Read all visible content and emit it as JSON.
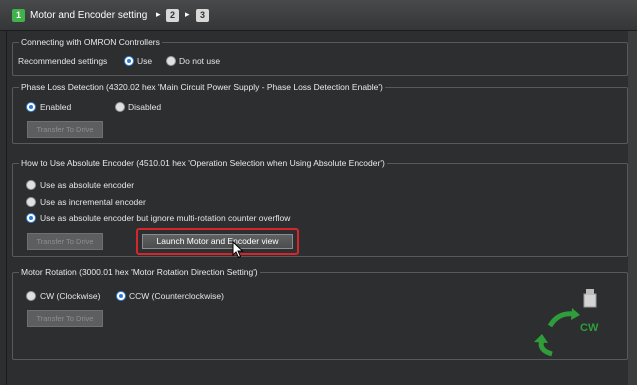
{
  "wizard": {
    "step1_number": "1",
    "step1_label": "Motor and Encoder setting",
    "step2_number": "2",
    "step3_number": "3",
    "breadcrumb_separator": "▸"
  },
  "omron": {
    "legend": "Connecting with OMRON Controllers",
    "recommended_label": "Recommended settings",
    "use_label": "Use",
    "do_not_use_label": "Do not use",
    "selected": "Use"
  },
  "phase_loss": {
    "legend": "Phase Loss Detection (4320.02 hex 'Main Circuit Power Supply - Phase Loss Detection Enable')",
    "enabled_label": "Enabled",
    "disabled_label": "Disabled",
    "selected": "Enabled",
    "transfer_label": "Transfer To Drive"
  },
  "absolute_encoder": {
    "legend": "How to Use Absolute Encoder (4510.01 hex 'Operation Selection when Using Absolute Encoder')",
    "options": [
      "Use as absolute encoder",
      "Use as incremental encoder",
      "Use as absolute encoder but ignore multi-rotation counter overflow"
    ],
    "selected_index": 2,
    "transfer_label": "Transfer To Drive",
    "launch_label": "Launch Motor and Encoder view"
  },
  "rotation": {
    "legend": "Motor Rotation (3000.01 hex 'Motor Rotation Direction Setting')",
    "cw_label": "CW (Clockwise)",
    "ccw_label": "CCW (Counterclockwise)",
    "selected": "CCW",
    "transfer_label": "Transfer To Drive",
    "diagram_label": "CW"
  },
  "colors": {
    "accent_green": "#3fb34a",
    "highlight_red": "#d6262b",
    "radio_blue": "#2f79cf"
  }
}
